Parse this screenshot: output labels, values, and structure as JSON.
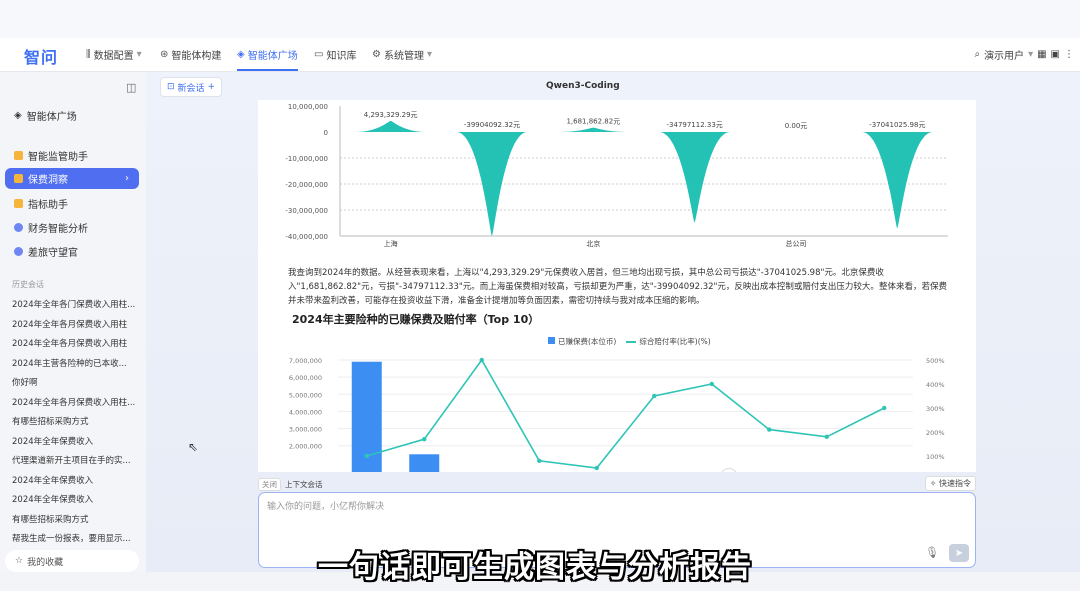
{
  "app": {
    "logo": "智问"
  },
  "nav": {
    "items": [
      {
        "label": "数据配置",
        "icon": "data-icon",
        "dropdown": true
      },
      {
        "label": "智能体构建",
        "icon": "robot-icon",
        "dropdown": false
      },
      {
        "label": "智能体广场",
        "icon": "cube-icon",
        "dropdown": false,
        "active": true
      },
      {
        "label": "知识库",
        "icon": "book-icon",
        "dropdown": false
      },
      {
        "label": "系统管理",
        "icon": "gear-icon",
        "dropdown": true
      }
    ],
    "user": "演示用户"
  },
  "sidebar": {
    "square_label": "智能体广场",
    "agents": [
      {
        "label": "智能监管助手",
        "icon": "lock-icon"
      },
      {
        "label": "保费洞察",
        "icon": "lock-icon",
        "active": true
      },
      {
        "label": "指标助手",
        "icon": "lock-icon"
      },
      {
        "label": "财务智能分析",
        "icon": "dot-icon"
      },
      {
        "label": "差旅守望官",
        "icon": "dot-icon"
      }
    ],
    "history_title": "历史会话",
    "history": [
      "2024年全年各门保费收入用柱...",
      "2024年全年各月保费收入用柱",
      "2024年全年各月保费收入用柱",
      "2024年主营各险种的已本收...",
      "你好啊",
      "2024年全年各月保费收入用柱...",
      "有哪些招标采购方式",
      "2024年全年保费收入",
      "代理渠道新开主项目在手的实...",
      "2024年全年保费收入",
      "2024年全年保费收入",
      "有哪些招标采购方式",
      "帮我生成一份报表，要用显示..."
    ],
    "bottom_label": "我的收藏"
  },
  "main": {
    "new_chat": "新会话",
    "model_title": "Qwen3-Coding",
    "analysis_text": "我查询到2024年的数据。从经营表现来看，上海以\"4,293,329.29\"元保费收入居首，但三地均出现亏损，其中总公司亏损达\"-37041025.98\"元。北京保费收入\"1,681,862.82\"元，亏损\"-34797112.33\"元。而上海虽保费相对较高，亏损却更为严重，达\"-39904092.32\"元，反映出成本控制或赔付支出压力较大。整体来看，若保费并未带来盈利改善，可能存在投资收益下滑，准备金计提增加等负面因素，需密切持续与我对成本压缩的影响。",
    "context_label": "上下文会话",
    "context_toggle": "关闭",
    "quick_label": "快速指令",
    "input_placeholder": "输入你的问题，小亿帮你解决",
    "caption": "一句话即可生成图表与分析报告"
  },
  "chart_data": [
    {
      "type": "area",
      "title": "",
      "categories": [
        "上海",
        "北京",
        "总公司"
      ],
      "series_labels": [
        "4,293,329.29元",
        "-39904092.32元",
        "1,681,862.82元",
        "-34797112.33元",
        "0.00元",
        "-37041025.98元"
      ],
      "values": [
        4293329.29,
        -39904092.32,
        1681862.82,
        -34797112.33,
        0,
        -37041025.98
      ],
      "ytick_labels": [
        "10,000,000",
        "0",
        "-10,000,000",
        "-20,000,000",
        "-30,000,000",
        "-40,000,000"
      ],
      "ylim": [
        -40000000,
        10000000
      ],
      "color": "#24c1b5"
    },
    {
      "type": "bar",
      "title": "2024年主要险种的已赚保费及赔付率（Top 10）",
      "legend": [
        "已赚保费(本位币)",
        "综合赔付率(比率)(%)"
      ],
      "bar_values": [
        6900000,
        1500000,
        150000,
        0,
        0,
        0,
        0,
        0,
        0,
        0
      ],
      "line_values": [
        100,
        170,
        500,
        80,
        50,
        350,
        400,
        210,
        180,
        300
      ],
      "y_left_ticks": [
        "7,000,000",
        "6,000,000",
        "5,000,000",
        "4,000,000",
        "3,000,000",
        "2,000,000"
      ],
      "y_right_ticks": [
        "500%",
        "400%",
        "300%",
        "200%",
        "100%"
      ],
      "ylim_left": [
        0,
        7000000
      ],
      "ylim_right": [
        0,
        500
      ],
      "bar_color": "#3d8ef3",
      "line_color": "#2ec5b6"
    }
  ]
}
